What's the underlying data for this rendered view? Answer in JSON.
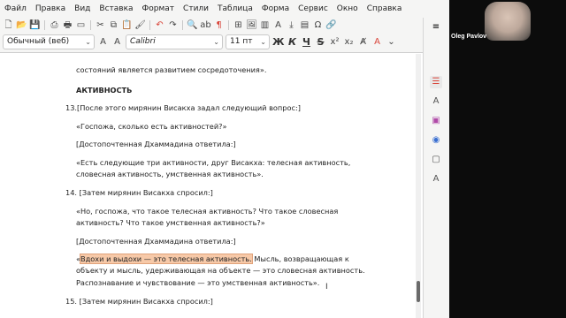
{
  "menu": [
    "Файл",
    "Правка",
    "Вид",
    "Вставка",
    "Формат",
    "Стили",
    "Таблица",
    "Форма",
    "Сервис",
    "Окно",
    "Справка"
  ],
  "format": {
    "paragraph_style": "Обычный (веб)",
    "font_name": "Calibri",
    "font_size": "11 пт",
    "bold_label": "Ж",
    "italic_label": "К",
    "underline_label": "Ч",
    "strike_label": "S"
  },
  "document": {
    "lines": [
      {
        "text": "состояний является развитием сосредоточения»."
      },
      {
        "text": "АКТИВНОСТЬ"
      },
      {
        "text": "13.[После этого мирянин Висакха задал следующий вопрос:]"
      },
      {
        "text": "«Госпожа, сколько есть активностей?»"
      },
      {
        "text": "[Достопочтенная Дхаммадина ответила:]"
      },
      {
        "text": "«Есть следующие три активности, друг Висакха: телесная активность,"
      },
      {
        "text": "словесная активность, умственная активность»."
      },
      {
        "text": "14. [Затем мирянин Висакха спросил:]"
      },
      {
        "text": "«Но, госпожа, что такое телесная активность? Что такое словесная"
      },
      {
        "text": "активность? Что такое умственная активность?»"
      },
      {
        "text": "[Достопочтенная Дхаммадина ответила:]"
      },
      {
        "text_prefix": "«",
        "text_highlight": "Вдохи и выдохи — это телесная активность.",
        "text_suffix": " Мысль, возвращающая к"
      },
      {
        "text": "объекту и мысль, удерживающая на объекте — это словесная активность."
      },
      {
        "text": "Распознавание и чувствование — это умственная активность»."
      },
      {
        "text": "15. [Затем мирянин Висакха спросил:]"
      }
    ]
  },
  "video": {
    "participant_name": "Oleg Pavlov"
  },
  "colors": {
    "highlight": "#f7c9a8",
    "accent_red": "#d9453a"
  }
}
